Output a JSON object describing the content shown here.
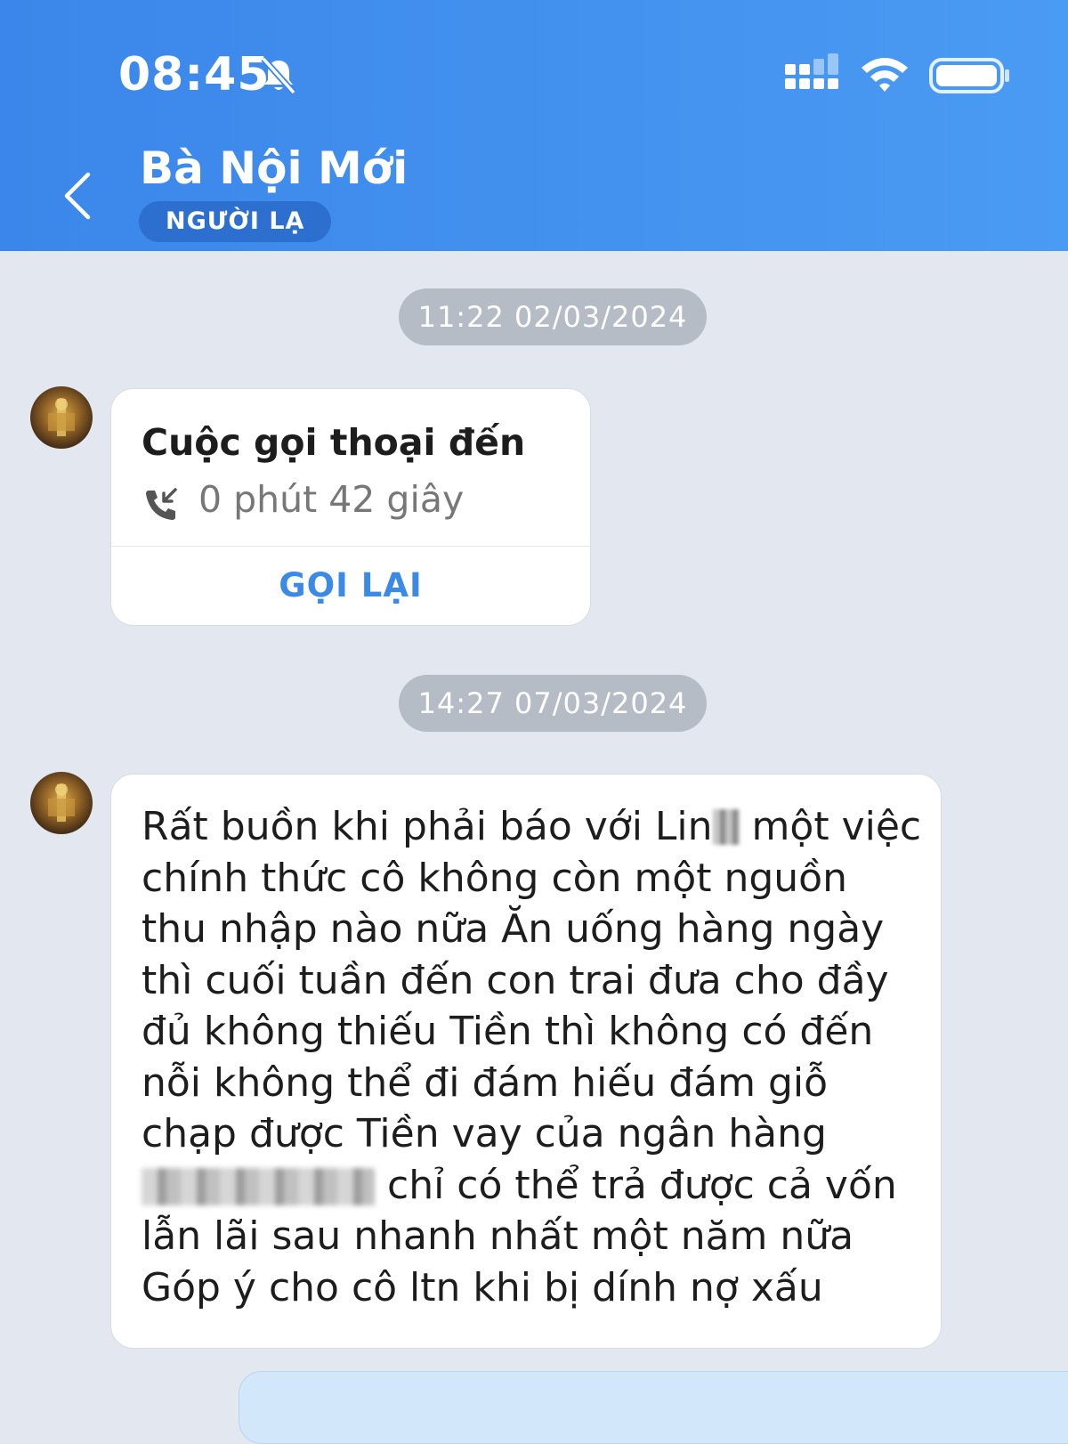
{
  "status_bar": {
    "time": "08:45",
    "icons": [
      "bell-off-icon",
      "signal-icon",
      "wifi-icon",
      "battery-icon"
    ]
  },
  "header": {
    "contact_name": "Bà Nội Mới",
    "badge": "NGƯỜI LẠ",
    "back_icon": "chevron-left-icon"
  },
  "messages": [
    {
      "timestamp": "11:22 02/03/2024",
      "type": "call",
      "call_title": "Cuộc gọi thoại đến",
      "call_duration": "0 phút 42 giây",
      "call_icon": "incoming-call-icon",
      "call_action": "GỌI LẠI"
    },
    {
      "timestamp": "14:27 07/03/2024",
      "type": "text",
      "lines": [
        "Rất buồn khi phải báo với Lin",
        "một việc",
        "chính thức cô không còn một nguồn",
        "thu nhập nào nữa Ăn uống hàng ngày",
        "thì cuối tuần đến con trai đưa cho đầy",
        "đủ không thiếu Tiền thì không có đến",
        "nỗi không thể đi đám hiếu đám giỗ",
        "chạp được Tiền vay của ngân hàng",
        "chỉ có thể trả được cả vốn",
        "lẫn lãi sau nhanh nhất một năm nữa",
        "Góp ý cho cô ltn khi bị dính nợ xấu"
      ]
    }
  ],
  "colors": {
    "header_start": "#3b86ea",
    "header_end": "#4a9bf3",
    "background": "#e3e8f0",
    "accent": "#3b8ae6",
    "badge": "#2d6fcf",
    "timestamp_pill": "#b5bcc6"
  }
}
